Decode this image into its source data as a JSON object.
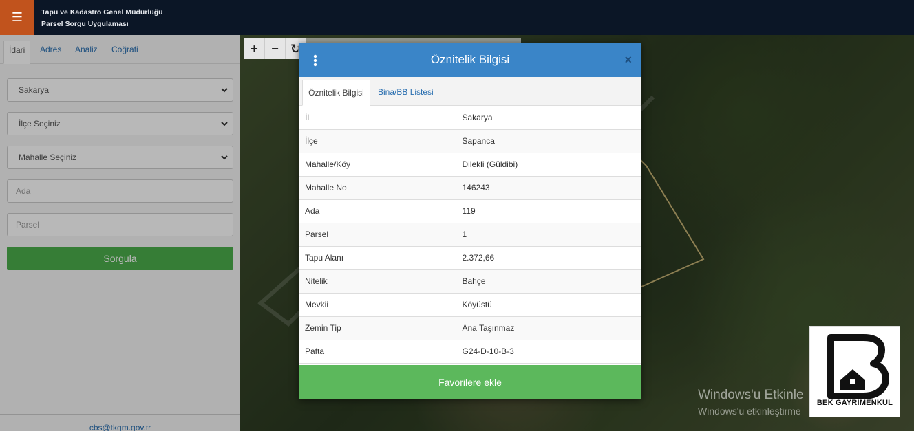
{
  "header": {
    "org_title": "Tapu ve Kadastro Genel Müdürlüğü",
    "app_title": "Parsel Sorgu Uygulaması",
    "menu_icon": "hamburger-icon"
  },
  "sidebar": {
    "tabs": [
      {
        "label": "İdari",
        "active": true
      },
      {
        "label": "Adres",
        "active": false
      },
      {
        "label": "Analiz",
        "active": false
      },
      {
        "label": "Coğrafi",
        "active": false
      }
    ],
    "province_select": "Sakarya",
    "district_select": "İlçe Seçiniz",
    "neighborhood_select": "Mahalle Seçiniz",
    "ada_placeholder": "Ada",
    "parsel_placeholder": "Parsel",
    "query_button": "Sorgula",
    "footer_email": "cbs@tkgm.gov.tr"
  },
  "map": {
    "zoom_in": "+",
    "zoom_out": "−",
    "windows_activation_title": "Windows'u Etkinle",
    "windows_activation_sub": "Windows'u etkinleştirme",
    "logo_caption": "BEK GAYRİMENKUL",
    "parcel_line_color": "#d9c47e"
  },
  "modal": {
    "title": "Öznitelik Bilgisi",
    "close": "×",
    "tabs": [
      {
        "label": "Öznitelik Bilgisi",
        "active": true
      },
      {
        "label": "Bina/BB Listesi",
        "active": false
      }
    ],
    "rows": [
      {
        "key": "İl",
        "value": "Sakarya"
      },
      {
        "key": "İlçe",
        "value": "Sapanca"
      },
      {
        "key": "Mahalle/Köy",
        "value": "Dilekli (Güldibi)"
      },
      {
        "key": "Mahalle No",
        "value": "146243"
      },
      {
        "key": "Ada",
        "value": "119"
      },
      {
        "key": "Parsel",
        "value": "1"
      },
      {
        "key": "Tapu Alanı",
        "value": "2.372,66"
      },
      {
        "key": "Nitelik",
        "value": "Bahçe"
      },
      {
        "key": "Mevkii",
        "value": "Köyüstü"
      },
      {
        "key": "Zemin Tip",
        "value": "Ana Taşınmaz"
      },
      {
        "key": "Pafta",
        "value": "G24-D-10-B-3"
      }
    ],
    "favorite_button": "Favorilere ekle"
  },
  "colors": {
    "header_bg": "#0b1626",
    "menu_accent": "#c1531d",
    "modal_header": "#3a85c8",
    "success_green": "#5cb85c"
  }
}
